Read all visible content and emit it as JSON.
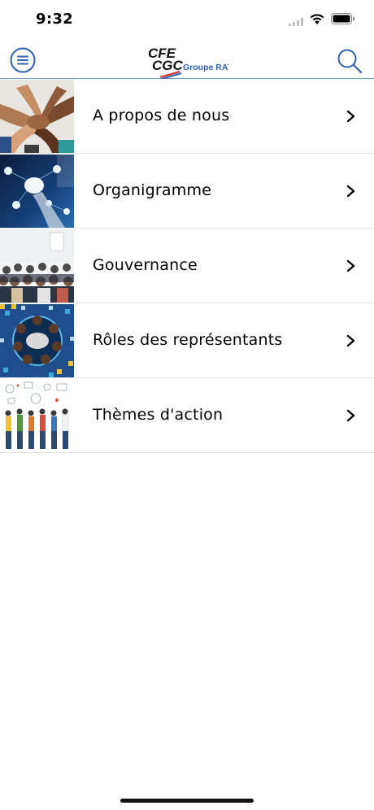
{
  "status_bar": {
    "time": "9:32"
  },
  "header": {
    "logo_primary": "CFE CGC",
    "logo_secondary": "Groupe RATP",
    "brand_color": "#2f62b4"
  },
  "menu": {
    "items": [
      {
        "label": "A propos de nous",
        "image": "stacked-hands-photo"
      },
      {
        "label": "Organigramme",
        "image": "network-hand-photo"
      },
      {
        "label": "Gouvernance",
        "image": "conference-audience-photo"
      },
      {
        "label": "Rôles des représentants",
        "image": "meeting-table-photo"
      },
      {
        "label": "Thèmes d'action",
        "image": "people-with-icons-photo"
      }
    ]
  }
}
